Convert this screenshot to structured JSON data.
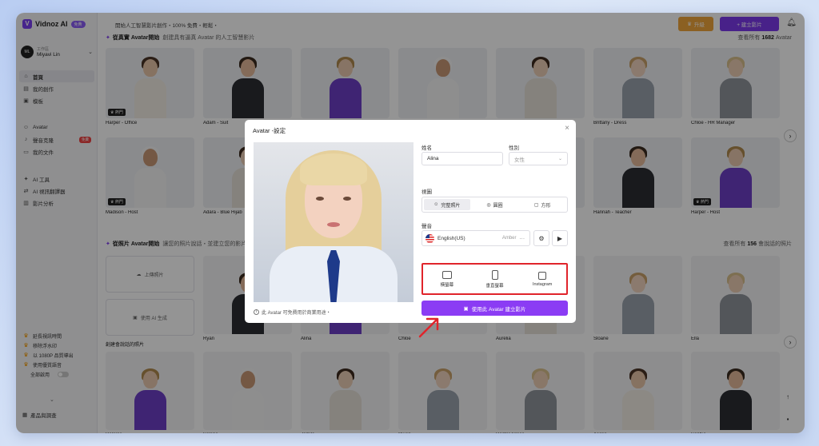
{
  "brand": {
    "name": "Vidnoz AI",
    "badge": "免費"
  },
  "user": {
    "workspace": "工作區",
    "name": "Miyavi Lin",
    "initials": "ML"
  },
  "nav": [
    {
      "label": "首頁",
      "icon": "home-icon",
      "glyph": "⌂"
    },
    {
      "label": "我的創作",
      "icon": "folder-icon",
      "glyph": "▤"
    },
    {
      "label": "模板",
      "icon": "template-icon",
      "glyph": "▣"
    },
    {
      "label": "Avatar",
      "icon": "avatar-icon",
      "glyph": "☺"
    },
    {
      "label": "聲音克隆",
      "icon": "voice-icon",
      "glyph": "♪",
      "tag": "免費"
    },
    {
      "label": "我的文件",
      "icon": "file-icon",
      "glyph": "▭"
    },
    {
      "label": "AI 工具",
      "icon": "ai-tools-icon",
      "glyph": "✦"
    },
    {
      "label": "AI 視訊翻譯器",
      "icon": "translate-icon",
      "glyph": "⇄"
    },
    {
      "label": "影片分析",
      "icon": "analytics-icon",
      "glyph": "▥"
    }
  ],
  "promo": [
    {
      "label": "延長視訊時間"
    },
    {
      "label": "移除浮水印"
    },
    {
      "label": "以 1080P 品質導出"
    },
    {
      "label": "使用優質語音"
    }
  ],
  "promo_toggle_label": "全部啟用",
  "feedback_label": "產品與調查",
  "topbar": {
    "promo": "開始人工智慧影片創作・100% 免費・輕鬆・",
    "upgrade": "升級",
    "create": "+ 建立影片"
  },
  "section1": {
    "title": "從真實 Avatar開始",
    "subtitle": "創建具有逼真 Avatar 的人工智慧影片",
    "all_prefix": "查看所有",
    "count": "1682",
    "all_suffix": "Avatar"
  },
  "row1": [
    {
      "name": "Harper - Office",
      "hot": "熱門"
    },
    {
      "name": "Adam - Suit"
    },
    {
      "name": ""
    },
    {
      "name": ""
    },
    {
      "name": ""
    },
    {
      "name": "Brittany - Dress"
    },
    {
      "name": "Chloe - HR Manager"
    }
  ],
  "row2": [
    {
      "name": "Madison - Host",
      "hot": "熱門"
    },
    {
      "name": "Adara - Blue Hijab"
    },
    {
      "name": ""
    },
    {
      "name": ""
    },
    {
      "name": ""
    },
    {
      "name": "Hannah - Teacher"
    },
    {
      "name": "Harper - Host",
      "hot": "熱門"
    }
  ],
  "section2": {
    "title": "從照片 Avatar開始",
    "subtitle": "讓您的照片說話・並建立您的影片",
    "all_prefix": "查看所有",
    "count": "156",
    "all_suffix": "會說話的照片"
  },
  "upload": {
    "upload_label": "上傳照片",
    "ai_label": "使用 AI 生成",
    "create_label": "創建會說話的照片"
  },
  "row3_names": [
    "Ryan",
    "Alina",
    "Chloe",
    "Aurelia",
    "Sloane",
    "Ella"
  ],
  "row4_names": [
    "Delores",
    "Selena",
    "Jamila",
    "Owen",
    "Doctor Grace",
    "Asako",
    "Sophia"
  ],
  "modal": {
    "title": "Avatar -設定",
    "note": "此 Avatar 可免費用於商業用途・",
    "name_label": "姓名",
    "name_value": "Alina",
    "gender_label": "性別",
    "gender_value": "女性",
    "view_label": "視圖",
    "views": [
      {
        "label": "完整照片",
        "icon": "full-photo-icon"
      },
      {
        "label": "圓圈",
        "icon": "circle-icon"
      },
      {
        "label": "方形",
        "icon": "square-icon"
      }
    ],
    "voice_label": "聲音",
    "voice_lang": "English(US)",
    "voice_name": "Amber",
    "formats": [
      {
        "label": "橫螢幕",
        "icon": "landscape-icon"
      },
      {
        "label": "垂直螢幕",
        "icon": "portrait-icon"
      },
      {
        "label": "Instagram",
        "icon": "instagram-icon"
      }
    ],
    "cta": "使用此 Avatar 建立影片"
  },
  "colors": {
    "accent": "#7c3aed",
    "upgrade": "#f0a63c",
    "highlight": "#e0242b"
  }
}
